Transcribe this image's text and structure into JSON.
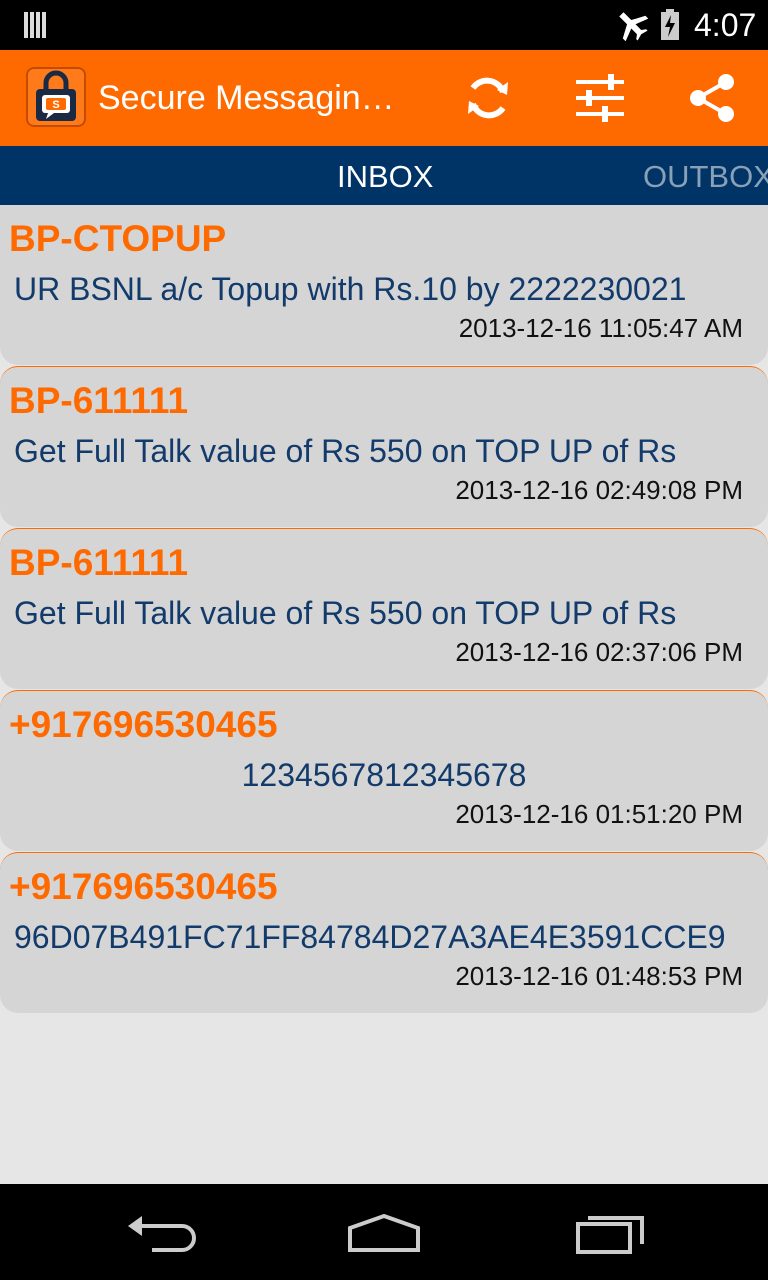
{
  "status_bar": {
    "time": "4:07"
  },
  "app": {
    "title": "Secure Messagin…"
  },
  "tabs": [
    {
      "label": "INBOX",
      "active": true
    },
    {
      "label": "OUTBOX",
      "active": false
    }
  ],
  "messages": [
    {
      "sender": "BP-CTOPUP",
      "body": "UR BSNL a/c Topup with Rs.10 by 2222230021",
      "time": "2013-12-16 11:05:47 AM"
    },
    {
      "sender": "BP-611111",
      "body": "Get Full Talk value of Rs 550 on TOP UP of Rs",
      "time": "2013-12-16 02:49:08 PM"
    },
    {
      "sender": "BP-611111",
      "body": "Get Full Talk value of Rs 550 on TOP UP of Rs",
      "time": "2013-12-16 02:37:06 PM"
    },
    {
      "sender": "+917696530465",
      "body": "1234567812345678",
      "time": "2013-12-16 01:51:20 PM"
    },
    {
      "sender": "+917696530465",
      "body": "96D07B491FC71FF84784D27A3AE4E3591CCE9",
      "time": "2013-12-16 01:48:53 PM"
    }
  ],
  "colors": {
    "accent": "#ff6a00",
    "tab_bar": "#003366",
    "body_text": "#123b6b"
  },
  "icons": [
    "signal-icon",
    "airplane-icon",
    "battery-icon",
    "app-icon",
    "refresh-icon",
    "settings-icon",
    "share-icon",
    "back-icon",
    "home-icon",
    "recent-apps-icon"
  ]
}
